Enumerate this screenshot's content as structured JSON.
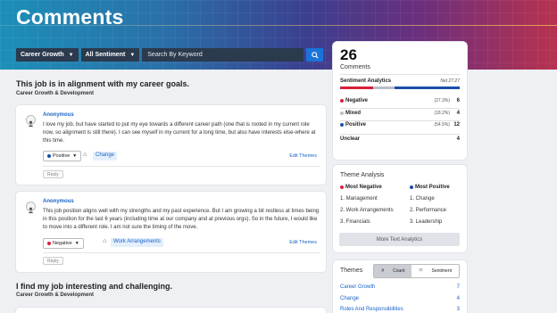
{
  "page": {
    "title": "Comments"
  },
  "filters": {
    "topic": "Career Growth",
    "sentiment": "All Sentiment",
    "search_placeholder": "Search By Keyword"
  },
  "sections": [
    {
      "title": "This job is in alignment with my career goals.",
      "subtitle": "Career Growth & Development"
    },
    {
      "title": "I find my job interesting and challenging.",
      "subtitle": "Career Growth & Development"
    }
  ],
  "comments": [
    {
      "author": "Anonymous",
      "text": "I love my job, but have started to put my eye towards a different career path (one that is rooted in my current role now, so alignment is still there). I can see myself in my current for a long time, but also have interests else-where at this time.",
      "sentiment": "Positive",
      "sentiment_color": "#1a4fa8",
      "tag": "Change",
      "edit_label": "Edit Themes",
      "reply_label": "Reply"
    },
    {
      "author": "Anonymous",
      "text": "This job position aligns well with my strengths and my past experience. But I am growing a bit restless at times being in this position for the last 6 years (including time at our company and at previous orgs). So in the future, I would like to move into a different role. I am not sure the timing of the move.",
      "sentiment": "Negative",
      "sentiment_color": "#d6203a",
      "tag": "Work Arrangements",
      "edit_label": "Edit Themes",
      "reply_label": "Reply"
    }
  ],
  "summary": {
    "count": "26",
    "count_label": "Comments",
    "sentiment_title": "Sentiment Analytics",
    "net_label": "Net 27.27",
    "rows": [
      {
        "name": "Negative",
        "pct": "(27.3%)",
        "count": "6",
        "color": "#d6203a",
        "fraction": 0.273
      },
      {
        "name": "Mixed",
        "pct": "(18.2%)",
        "count": "4",
        "color": "#b8bfc9",
        "fraction": 0.182
      },
      {
        "name": "Positive",
        "pct": "(54.5%)",
        "count": "12",
        "color": "#1a4fa8",
        "fraction": 0.545
      },
      {
        "name": "Unclear",
        "pct": "",
        "count": "4",
        "color": "",
        "fraction": 0
      }
    ]
  },
  "theme_analysis": {
    "title": "Theme Analysis",
    "negative_label": "Most Negative",
    "positive_label": "Most Positive",
    "negative": [
      "1. Management",
      "2. Work Arrangements",
      "3. Financials"
    ],
    "positive": [
      "1. Change",
      "2. Performance",
      "3. Leadership"
    ],
    "more_label": "More Text Analytics"
  },
  "themes": {
    "title": "Themes",
    "toggle_count": "Count",
    "toggle_sentiment": "Sentiment",
    "items": [
      {
        "name": "Career Growth",
        "value": "7"
      },
      {
        "name": "Change",
        "value": "4"
      },
      {
        "name": "Roles And Responsibilities",
        "value": "3"
      }
    ]
  }
}
